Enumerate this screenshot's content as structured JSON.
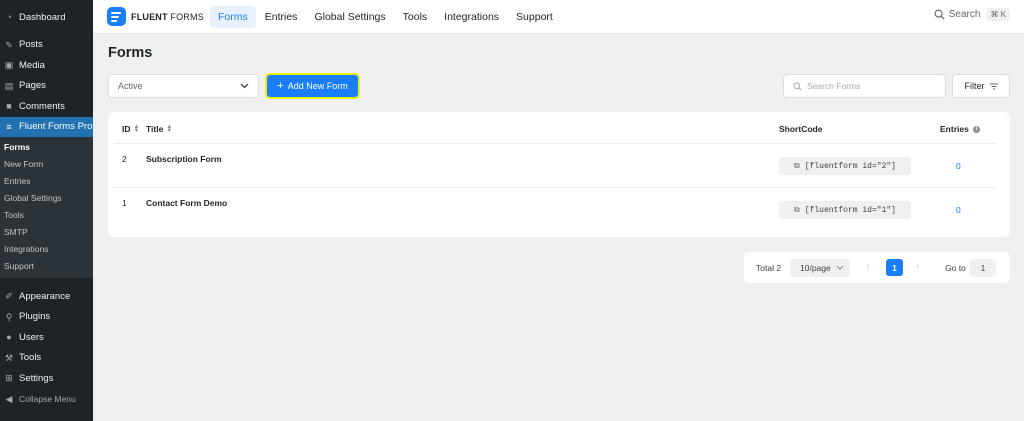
{
  "wp_sidebar": {
    "items_top": [
      {
        "label": "Dashboard",
        "icon": "dashboard-icon"
      },
      {
        "label": "Posts",
        "icon": "pin-icon"
      },
      {
        "label": "Media",
        "icon": "media-icon"
      },
      {
        "label": "Pages",
        "icon": "pages-icon"
      },
      {
        "label": "Comments",
        "icon": "comment-icon"
      }
    ],
    "active_item": {
      "label": "Fluent Forms Pro",
      "icon": "fluent-forms-icon"
    },
    "submenu": [
      "Forms",
      "New Form",
      "Entries",
      "Global Settings",
      "Tools",
      "SMTP",
      "Integrations",
      "Support"
    ],
    "items_bottom": [
      {
        "label": "Appearance",
        "icon": "brush-icon"
      },
      {
        "label": "Plugins",
        "icon": "plug-icon"
      },
      {
        "label": "Users",
        "icon": "user-icon"
      },
      {
        "label": "Tools",
        "icon": "wrench-icon"
      },
      {
        "label": "Settings",
        "icon": "settings-icon"
      }
    ],
    "collapse_label": "Collapse Menu"
  },
  "topbar": {
    "logo_bold": "FLUENT",
    "logo_light": "FORMS",
    "nav": [
      "Forms",
      "Entries",
      "Global Settings",
      "Tools",
      "Integrations",
      "Support"
    ],
    "active_nav": "Forms",
    "search_label": "Search",
    "search_shortcut": "⌘ K"
  },
  "page": {
    "title": "Forms",
    "status_value": "Active",
    "add_button_label": "Add New Form",
    "search_placeholder": "Search Forms",
    "filter_label": "Filter"
  },
  "table": {
    "columns": {
      "id": "ID",
      "title": "Title",
      "shortcode": "ShortCode",
      "entries": "Entries"
    },
    "rows": [
      {
        "id": "2",
        "title": "Subscription Form",
        "shortcode": "[fluentform id=\"2\"]",
        "entries": "0"
      },
      {
        "id": "1",
        "title": "Contact Form Demo",
        "shortcode": "[fluentform id=\"1\"]",
        "entries": "0"
      }
    ]
  },
  "pagination": {
    "total": "Total 2",
    "page_size": "10/page",
    "current_page": "1",
    "goto_label": "Go to",
    "goto_value": "1"
  },
  "colors": {
    "accent": "#1a7efb",
    "wp_sidebar_bg": "#1d2327",
    "wp_active": "#2271b1",
    "highlight_border": "#e8f01a"
  }
}
